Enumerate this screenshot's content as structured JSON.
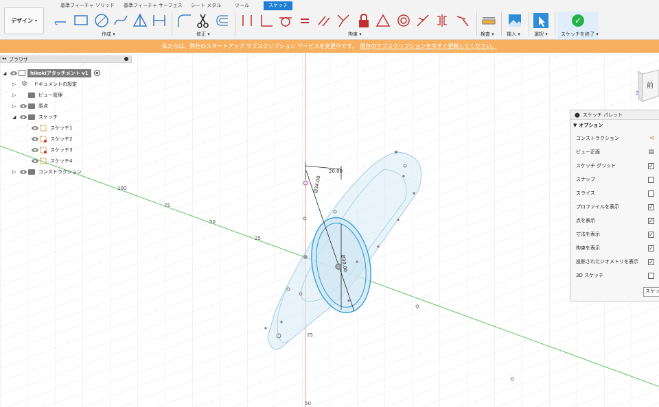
{
  "tabs": [
    "基準フィーチャ ソリッド",
    "基準フィーチャ サーフェス",
    "シート メタル",
    "ツール",
    "スケッチ"
  ],
  "design_button": "デザイン",
  "toolbar_groups": {
    "create": "作成",
    "modify": "修正",
    "constraints": "拘束",
    "inspect": "検査",
    "insert": "挿入",
    "select": "選択",
    "finish": "スケッチを終了"
  },
  "banner": {
    "text": "私たちは、弊社のスタートアップ サブスクリプション サービスを変更中です。",
    "link": "既存のサブスクリプションを今すぐ更新してください。"
  },
  "browser": {
    "title": "ブラウザ",
    "root": "hikokiアタッチメント v1",
    "items": [
      {
        "label": "ドキュメントの設定"
      },
      {
        "label": "ビュー管理"
      },
      {
        "label": "原点"
      },
      {
        "label": "スケッチ"
      },
      {
        "label": "スケッチ1"
      },
      {
        "label": "スケッチ2"
      },
      {
        "label": "スケッチ3"
      },
      {
        "label": "スケッチ4"
      },
      {
        "label": "コンストラクション"
      }
    ]
  },
  "palette": {
    "title": "スケッチ パレット",
    "section": "オプション",
    "rows": [
      {
        "label": "コンストラクション",
        "control": "icon"
      },
      {
        "label": "ビュー正面",
        "control": "icon"
      },
      {
        "label": "スケッチ グリッド",
        "checked": true
      },
      {
        "label": "スナップ",
        "checked": false
      },
      {
        "label": "スライス",
        "checked": false
      },
      {
        "label": "プロファイルを表示",
        "checked": true
      },
      {
        "label": "点を表示",
        "checked": true
      },
      {
        "label": "寸法を表示",
        "checked": true
      },
      {
        "label": "拘束を表示",
        "checked": true
      },
      {
        "label": "投影されたジオメトリを表示",
        "checked": true
      },
      {
        "label": "3D スケッチ",
        "checked": false
      }
    ],
    "finish_button": "スケッチを終了"
  },
  "dimensions": {
    "horizontal": "20.00",
    "diameter": "Ø34.00",
    "vertical": "Ø30.00"
  },
  "axis_labels": [
    "100",
    "75",
    "50",
    "25",
    "25",
    "50"
  ],
  "viewcube": {
    "face": "前",
    "axis": "Z"
  },
  "colors": {
    "accent": "#1f7fd4",
    "banner": "#f6b05f",
    "sketch": "#3ea3d6",
    "x_axis": "#5cc35c",
    "z_axis": "#e0a080"
  }
}
